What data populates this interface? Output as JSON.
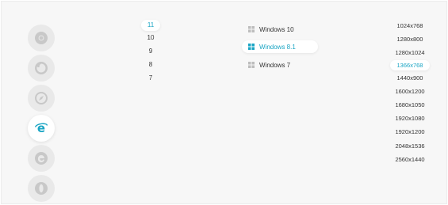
{
  "browsers": [
    {
      "name": "chrome-icon",
      "active": false
    },
    {
      "name": "firefox-icon",
      "active": false
    },
    {
      "name": "safari-icon",
      "active": false
    },
    {
      "name": "internet-explorer-icon",
      "active": true
    },
    {
      "name": "edge-icon",
      "active": false
    },
    {
      "name": "opera-icon",
      "active": false
    }
  ],
  "versions": {
    "items": [
      "11",
      "10",
      "9",
      "8",
      "7"
    ],
    "selected": "11"
  },
  "os": {
    "items": [
      "Windows 10",
      "Windows 8.1",
      "Windows 7"
    ],
    "selected": "Windows 8.1"
  },
  "resolutions": {
    "items": [
      "1024x768",
      "1280x800",
      "1280x1024",
      "1366x768",
      "1440x900",
      "1600x1200",
      "1680x1050",
      "1920x1080",
      "1920x1200",
      "2048x1536",
      "2560x1440"
    ],
    "selected": "1366x768"
  },
  "colors": {
    "accent": "#1aa5c4",
    "inactive_icon": "#c8c8c8",
    "circle_bg": "#e9e9e9"
  }
}
